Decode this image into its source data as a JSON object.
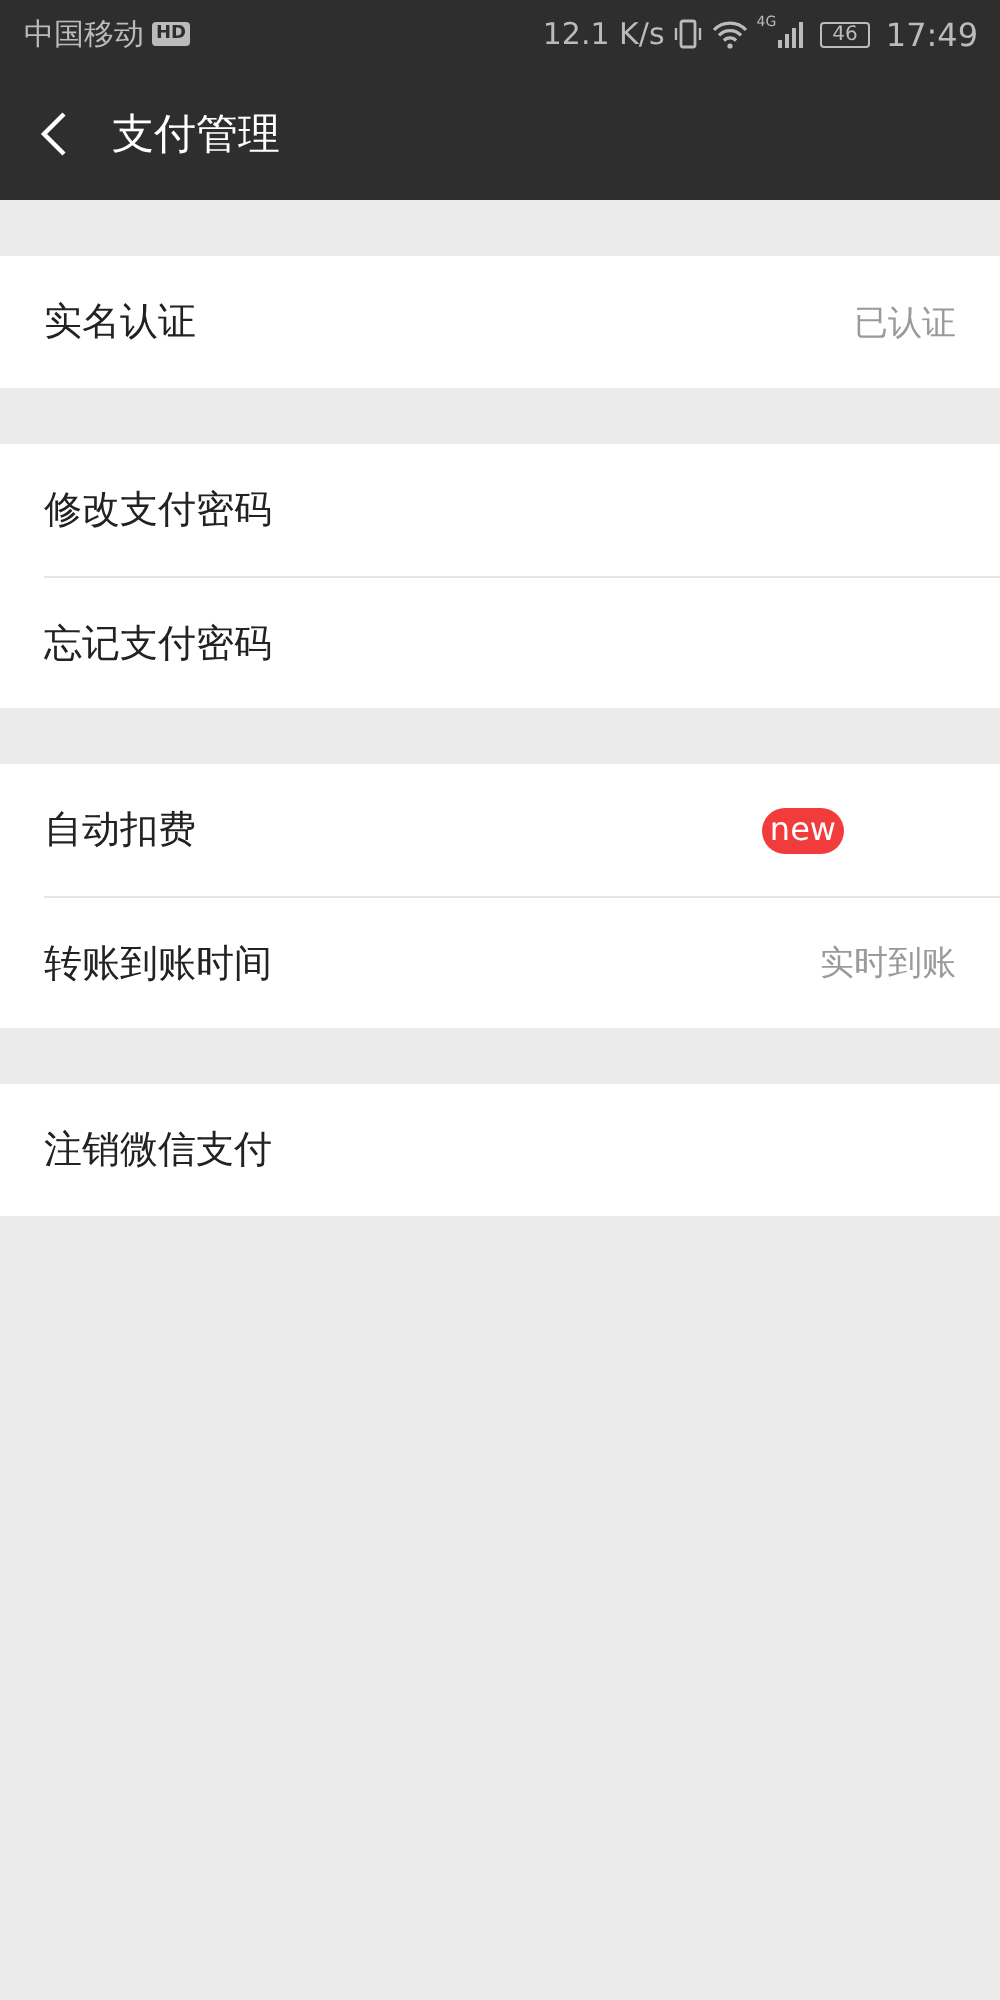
{
  "status_bar": {
    "carrier": "中国移动",
    "carrier_badge": "HD",
    "speed": "12.1 K/s",
    "network": "4G",
    "battery": "46",
    "time": "17:49"
  },
  "header": {
    "title": "支付管理"
  },
  "sections": [
    {
      "items": [
        {
          "label": "实名认证",
          "value": "已认证"
        }
      ]
    },
    {
      "items": [
        {
          "label": "修改支付密码"
        },
        {
          "label": "忘记支付密码"
        }
      ]
    },
    {
      "items": [
        {
          "label": "自动扣费",
          "badge": "new"
        },
        {
          "label": "转账到账时间",
          "value": "实时到账"
        }
      ]
    },
    {
      "items": [
        {
          "label": "注销微信支付"
        }
      ]
    }
  ]
}
